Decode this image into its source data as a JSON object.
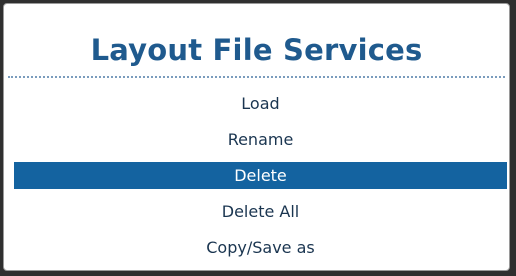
{
  "dialog": {
    "title": "Layout File Services",
    "accent_color": "#1f5a8e",
    "selection_color": "#1463a0",
    "items": [
      {
        "label": "Load",
        "selected": false
      },
      {
        "label": "Rename",
        "selected": false
      },
      {
        "label": "Delete",
        "selected": true
      },
      {
        "label": "Delete All",
        "selected": false
      },
      {
        "label": "Copy/Save as",
        "selected": false
      }
    ]
  }
}
